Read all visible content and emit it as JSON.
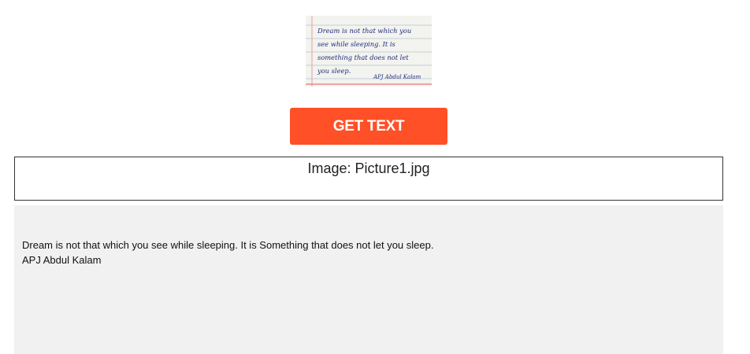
{
  "preview": {
    "image_lines": [
      "Dream is not that which you",
      "see while sleeping. It is",
      "something that does not let",
      "you sleep."
    ],
    "image_signature": "APJ Abdul Kalam"
  },
  "button": {
    "label": "GET TEXT",
    "color": "#ff5027"
  },
  "file": {
    "label": "Image: Picture1.jpg"
  },
  "result": {
    "lines": [
      "Dream is not that which you see while sleeping. It is Something that does not let you sleep.",
      "APJ Abdul Kalam"
    ],
    "background": "#f1f1f1"
  }
}
